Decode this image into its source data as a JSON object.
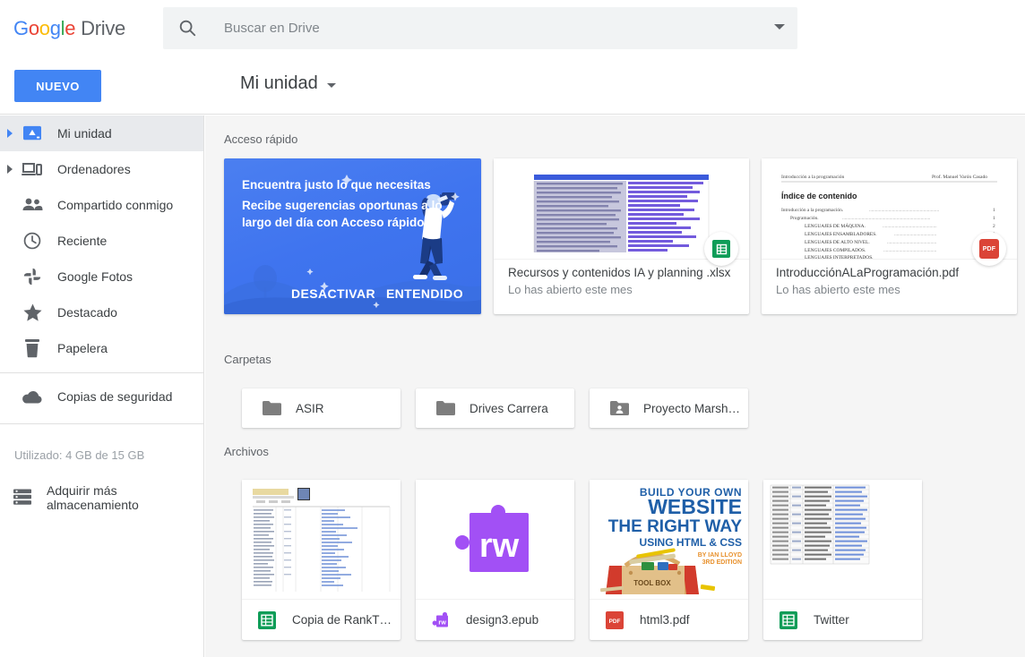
{
  "app": {
    "brand_google": "Google",
    "brand_product": "Drive"
  },
  "search": {
    "placeholder": "Buscar en Drive",
    "value": "",
    "icon": "search-icon",
    "caret_icon": "chevron-down-icon"
  },
  "toolbar": {
    "new_label": "NUEVO",
    "breadcrumb": "Mi unidad",
    "breadcrumb_caret": "chevron-down-icon"
  },
  "sidebar": {
    "items": [
      {
        "label": "Mi unidad",
        "icon": "drive-hdd-icon",
        "active": true,
        "expandable": true
      },
      {
        "label": "Ordenadores",
        "icon": "computers-icon",
        "active": false,
        "expandable": true
      },
      {
        "label": "Compartido conmigo",
        "icon": "people-icon",
        "active": false,
        "expandable": false
      },
      {
        "label": "Reciente",
        "icon": "clock-icon",
        "active": false,
        "expandable": false
      },
      {
        "label": "Google Fotos",
        "icon": "photos-pinwheel-icon",
        "active": false,
        "expandable": false
      },
      {
        "label": "Destacado",
        "icon": "star-icon",
        "active": false,
        "expandable": false
      },
      {
        "label": "Papelera",
        "icon": "trash-icon",
        "active": false,
        "expandable": false
      }
    ],
    "backups": {
      "label": "Copias de seguridad",
      "icon": "cloud-icon"
    },
    "storage_text": "Utilizado: 4 GB de 15 GB",
    "buy_storage": {
      "label": "Adquirir más almacenamiento",
      "icon": "storage-drives-icon"
    }
  },
  "main": {
    "quick_access_label": "Acceso rápido",
    "folders_label": "Carpetas",
    "files_label": "Archivos",
    "promo": {
      "title": "Encuentra justo lo que necesitas",
      "subtitle": "Recibe sugerencias oportunas a lo largo del día con Acceso rápido",
      "dismiss_label": "DESACTIVAR",
      "confirm_label": "ENTENDIDO",
      "bg_color": "#4285f4"
    },
    "quick_access": [
      {
        "name": "Recursos y contenidos IA y planning .xlsx",
        "subtitle": "Lo has abierto este mes",
        "badge": "sheets-icon",
        "thumb": "spreadsheet"
      },
      {
        "name": "IntroducciónALaProgramación.pdf",
        "subtitle": "Lo has abierto este mes",
        "badge": "pdf-icon",
        "thumb": "pdf-document",
        "doc_header_left": "Introducción a la programación",
        "doc_header_right": "Prof. Manuel Varón Casado",
        "doc_title": "Índice de contenido",
        "doc_lines": [
          "Introducción a la programación.",
          "Programación.",
          "LENGUAJES DE MÁQUINA.",
          "LENGUAJES ENSAMBLADORES.",
          "LENGUAJES DE ALTO NIVEL.",
          "LENGUAJES COMPILADOS."
        ]
      }
    ],
    "folders": [
      {
        "name": "ASIR",
        "icon": "folder-icon"
      },
      {
        "name": "Drives Carrera",
        "icon": "folder-icon"
      },
      {
        "name": "Proyecto Marsh…",
        "icon": "folder-shared-icon"
      }
    ],
    "files": [
      {
        "name": "Copia de RankT…",
        "icon": "sheets-icon",
        "thumb": "spreadsheet-light"
      },
      {
        "name": "design3.epub",
        "icon": "readwrite-puzzle-icon",
        "thumb": "readwrite-puzzle"
      },
      {
        "name": "html3.pdf",
        "icon": "pdf-icon",
        "thumb": "book-cover",
        "cover_line1": "BUILD YOUR OWN",
        "cover_line2": "WEBSITE",
        "cover_line3": "THE RIGHT WAY",
        "cover_line4": "USING HTML & CSS",
        "cover_author": "BY IAN LLOYD",
        "cover_edition": "3RD EDITION",
        "cover_toolbox_label": "TOOL BOX"
      },
      {
        "name": "Twitter",
        "icon": "sheets-icon",
        "thumb": "spreadsheet-links"
      }
    ]
  },
  "colors": {
    "accent": "#4285f4",
    "sheets_green": "#0f9d58",
    "pdf_red": "#db4437",
    "epub_purple": "#a250f5",
    "content_bg": "#f5f5f5",
    "sidebar_active": "#e8eaed"
  }
}
